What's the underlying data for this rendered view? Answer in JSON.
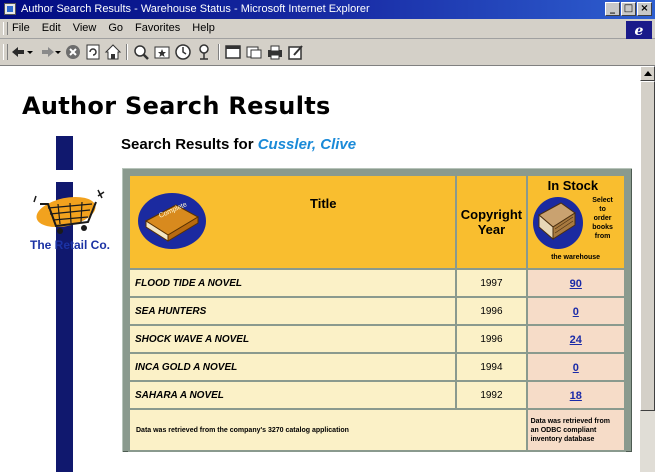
{
  "window": {
    "title": "Author Search Results - Warehouse Status - Microsoft Internet Explorer",
    "minimize": "_",
    "maximize": "□",
    "close": "×"
  },
  "menubar": {
    "items": [
      "File",
      "Edit",
      "View",
      "Go",
      "Favorites",
      "Help"
    ]
  },
  "toolbar": {
    "icons": [
      "back-icon",
      "forward-icon",
      "stop-icon",
      "refresh-icon",
      "home-icon",
      "search-icon",
      "favorites-icon",
      "history-icon",
      "channels-icon",
      "fullscreen-icon",
      "mail-icon",
      "print-icon",
      "edit-icon"
    ]
  },
  "page": {
    "title": "Author Search Results",
    "heading_prefix": "Search Results for",
    "author": "Cussler, Clive"
  },
  "logo": {
    "name": "The Retail Co."
  },
  "table": {
    "headers": {
      "title": "Title",
      "year_line1": "Copyright",
      "year_line2": "Year",
      "stock": "In Stock",
      "stock_note": [
        "Select",
        "to",
        "order",
        "books",
        "from"
      ],
      "stock_note_bottom": "the warehouse",
      "book_label": "Complete"
    },
    "rows": [
      {
        "title": "FLOOD TIDE A NOVEL",
        "year": "1997",
        "stock": "90"
      },
      {
        "title": "SEA HUNTERS",
        "year": "1996",
        "stock": "0"
      },
      {
        "title": "SHOCK WAVE A NOVEL",
        "year": "1996",
        "stock": "24"
      },
      {
        "title": "INCA GOLD A NOVEL",
        "year": "1994",
        "stock": "0"
      },
      {
        "title": "SAHARA A NOVEL",
        "year": "1992",
        "stock": "18"
      }
    ],
    "footer_left": "Data was retrieved from the company's 3270 catalog application",
    "footer_right": [
      "Data was retrieved from",
      "an ODBC compliant",
      "inventory database"
    ]
  },
  "colors": {
    "title_bar": "#000a80",
    "header_cell": "#f9be2f",
    "row_cell": "#fbf1c7",
    "stock_cell": "#f6dcc8",
    "author": "#1a8ad8",
    "link": "#1a2aa8",
    "left_bar": "#10186e"
  }
}
